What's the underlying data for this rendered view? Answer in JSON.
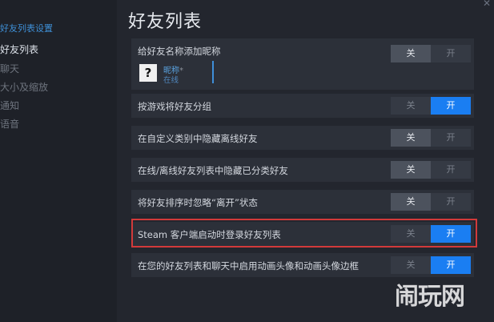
{
  "sidebar": {
    "title": "好友列表设置",
    "items": [
      {
        "label": "好友列表",
        "active": true
      },
      {
        "label": "聊天",
        "active": false
      },
      {
        "label": "大小及缩放",
        "active": false
      },
      {
        "label": "通知",
        "active": false
      },
      {
        "label": "语音",
        "active": false
      }
    ]
  },
  "page_title": "好友列表",
  "toggle_labels": {
    "off": "关",
    "on": "开"
  },
  "nickname_preview": {
    "avatar_glyph": "?",
    "nickname": "昵称",
    "asterisk": "*",
    "status": "在线"
  },
  "settings": [
    {
      "label": "给好友名称添加昵称",
      "state": "off"
    },
    {
      "label": "按游戏将好友分组",
      "state": "on"
    },
    {
      "label": "在自定义类别中隐藏离线好友",
      "state": "off"
    },
    {
      "label": "在线/离线好友列表中隐藏已分类好友",
      "state": "off"
    },
    {
      "label": "将好友排序时忽略“离开”状态",
      "state": "off"
    },
    {
      "label": "Steam 客户端启动时登录好友列表",
      "state": "on",
      "highlighted": true
    },
    {
      "label": "在您的好友列表和聊天中启用动画头像和动画头像边框",
      "state": "on"
    }
  ],
  "watermark": "闹玩网",
  "colors": {
    "accent": "#1a7ef2",
    "highlight_border": "#d23a3a"
  }
}
